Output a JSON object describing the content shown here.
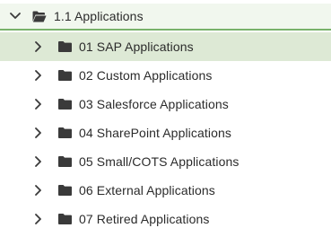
{
  "tree": {
    "root": {
      "label": "1.1 Applications",
      "expanded": true,
      "icon": "folder-open-icon",
      "chevron": "chevron-down-icon"
    },
    "children": [
      {
        "label": "01 SAP Applications",
        "selected": true,
        "icon": "folder-icon",
        "chevron": "chevron-right-icon"
      },
      {
        "label": "02 Custom Applications",
        "selected": false,
        "icon": "folder-icon",
        "chevron": "chevron-right-icon"
      },
      {
        "label": "03 Salesforce Applications",
        "selected": false,
        "icon": "folder-icon",
        "chevron": "chevron-right-icon"
      },
      {
        "label": "04 SharePoint Applications",
        "selected": false,
        "icon": "folder-icon",
        "chevron": "chevron-right-icon"
      },
      {
        "label": "05 Small/COTS Applications",
        "selected": false,
        "icon": "folder-icon",
        "chevron": "chevron-right-icon"
      },
      {
        "label": "06 External Applications",
        "selected": false,
        "icon": "folder-icon",
        "chevron": "chevron-right-icon"
      },
      {
        "label": "07 Retired Applications",
        "selected": false,
        "icon": "folder-icon",
        "chevron": "chevron-right-icon"
      }
    ]
  },
  "colors": {
    "root_background": "#f1f7ee",
    "root_underline": "#78b26a",
    "selected_background": "#dde9d5",
    "icon_color": "#3a3a3a",
    "text_color": "#2b2b2b"
  }
}
